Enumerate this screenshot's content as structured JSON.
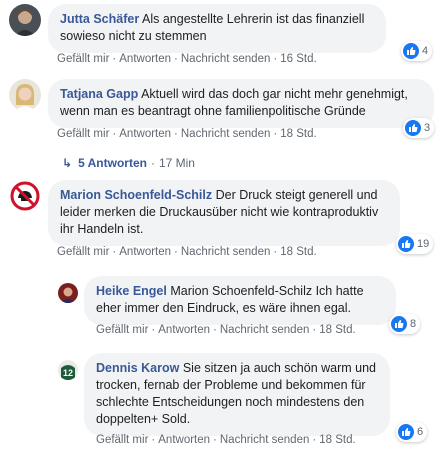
{
  "action_labels": {
    "like": "Gefällt mir",
    "reply": "Antworten",
    "message": "Nachricht senden",
    "separator": "·"
  },
  "comments": [
    {
      "author": "Jutta Schäfer",
      "text": "Als angestellte Lehrerin ist das finanziell sowieso nicht zu stemmen",
      "time": "16 Std.",
      "likes": "4"
    },
    {
      "author": "Tatjana Gapp",
      "text": "Aktuell wird das doch gar nicht mehr genehmigt, wenn man es beantragt ohne familienpolitische Gründe",
      "time": "18 Std.",
      "likes": "3",
      "replies": {
        "label": "5 Antworten",
        "time": "17 Min"
      }
    },
    {
      "author": "Marion Schoenfeld-Schilz",
      "text": "Der Druck steigt generell und leider merken die Druckausüber nicht wie kontraproduktiv ihr Handeln ist.",
      "time": "18 Std.",
      "likes": "19"
    },
    {
      "author": "Heike Engel",
      "text": "Marion Schoenfeld-Schilz Ich hatte eher immer den Eindruck, es wäre ihnen egal.",
      "time": "18 Std.",
      "likes": "8"
    },
    {
      "author": "Dennis Karow",
      "text": "Sie sitzen ja auch schön warm und trocken, fernab der Probleme und bekommen für schlechte Entscheidungen noch mindestens den doppelten+ Sold.",
      "time": "18 Std.",
      "likes": "6"
    }
  ],
  "colors": {
    "author": "#385898",
    "bubble": "#f2f3f5",
    "like": "#1877f2",
    "meta": "#606770"
  },
  "icons": [
    "user-avatar",
    "like-icon",
    "reply-arrow-icon"
  ]
}
